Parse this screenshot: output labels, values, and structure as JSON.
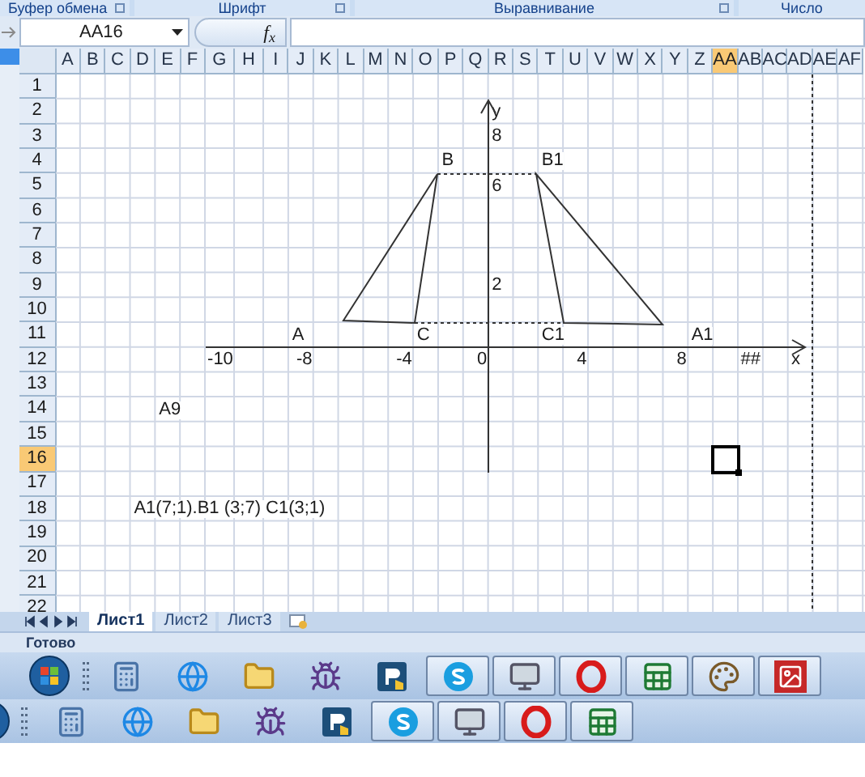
{
  "ribbon_groups": [
    {
      "label": "Буфер обмена"
    },
    {
      "label": "Шрифт"
    },
    {
      "label": "Выравнивание"
    },
    {
      "label": "Число"
    }
  ],
  "name_box": {
    "value": "AA16"
  },
  "formula_bar": {
    "function_label": "f$_{x}$"
  },
  "columns": [
    {
      "label": "A",
      "selected": false
    },
    {
      "label": "B",
      "selected": false
    },
    {
      "label": "C",
      "selected": false
    },
    {
      "label": "D",
      "selected": false
    },
    {
      "label": "E",
      "selected": false
    },
    {
      "label": "F",
      "selected": false
    },
    {
      "label": "G",
      "selected": false
    },
    {
      "label": "H",
      "selected": false
    },
    {
      "label": "I",
      "selected": false
    },
    {
      "label": "J",
      "selected": false
    },
    {
      "label": "K",
      "selected": false
    },
    {
      "label": "L",
      "selected": false
    },
    {
      "label": "M",
      "selected": false
    },
    {
      "label": "N",
      "selected": false
    },
    {
      "label": "O",
      "selected": false
    },
    {
      "label": "P",
      "selected": false
    },
    {
      "label": "Q",
      "selected": false
    },
    {
      "label": "R",
      "selected": false
    },
    {
      "label": "S",
      "selected": false
    },
    {
      "label": "T",
      "selected": false
    },
    {
      "label": "U",
      "selected": false
    },
    {
      "label": "V",
      "selected": false
    },
    {
      "label": "W",
      "selected": false
    },
    {
      "label": "X",
      "selected": false
    },
    {
      "label": "Y",
      "selected": false
    },
    {
      "label": "Z",
      "selected": false
    },
    {
      "label": "AA",
      "selected": true
    },
    {
      "label": "AB",
      "selected": false
    },
    {
      "label": "AC",
      "selected": false
    },
    {
      "label": "AD",
      "selected": false
    },
    {
      "label": "AE",
      "selected": false
    },
    {
      "label": "AF",
      "selected": false
    }
  ],
  "rows": [
    {
      "label": "1",
      "selected": false
    },
    {
      "label": "2",
      "selected": false
    },
    {
      "label": "3",
      "selected": false
    },
    {
      "label": "4",
      "selected": false
    },
    {
      "label": "5",
      "selected": false
    },
    {
      "label": "6",
      "selected": false
    },
    {
      "label": "7",
      "selected": false
    },
    {
      "label": "8",
      "selected": false
    },
    {
      "label": "9",
      "selected": false
    },
    {
      "label": "10",
      "selected": false
    },
    {
      "label": "11",
      "selected": false
    },
    {
      "label": "12",
      "selected": false
    },
    {
      "label": "13",
      "selected": false
    },
    {
      "label": "14",
      "selected": false
    },
    {
      "label": "15",
      "selected": false
    },
    {
      "label": "16",
      "selected": true
    },
    {
      "label": "17",
      "selected": false
    },
    {
      "label": "18",
      "selected": false
    },
    {
      "label": "19",
      "selected": false
    },
    {
      "label": "20",
      "selected": false
    },
    {
      "label": "21",
      "selected": false
    },
    {
      "label": "22",
      "selected": false
    }
  ],
  "cells": [
    {
      "text": "y"
    },
    {
      "text": "8"
    },
    {
      "text": "B"
    },
    {
      "text": "B1"
    },
    {
      "text": "6"
    },
    {
      "text": "2"
    },
    {
      "text": "A"
    },
    {
      "text": "C"
    },
    {
      "text": "C1"
    },
    {
      "text": "A1"
    },
    {
      "text": "-10"
    },
    {
      "text": "-8"
    },
    {
      "text": "-4"
    },
    {
      "text": "0"
    },
    {
      "text": "4"
    },
    {
      "text": "8"
    },
    {
      "text": "##"
    },
    {
      "text": "x"
    },
    {
      "text": "A9"
    },
    {
      "text": "A1(7;1).B1 (3;7)  C1(3;1)"
    }
  ],
  "sheet_tabs": [
    {
      "label": "Лист1",
      "selected": true
    },
    {
      "label": "Лист2",
      "selected": false
    },
    {
      "label": "Лист3",
      "selected": false
    }
  ],
  "status_bar": {
    "text": "Готово"
  },
  "taskbars": [
    {
      "items": [
        {
          "kind": "calculator",
          "running": false
        },
        {
          "kind": "browser",
          "running": false
        },
        {
          "kind": "folder",
          "running": false
        },
        {
          "kind": "spider",
          "running": false
        },
        {
          "kind": "remote",
          "running": false
        },
        {
          "kind": "skype",
          "running": true
        },
        {
          "kind": "monitor",
          "running": true
        },
        {
          "kind": "opera",
          "running": true
        },
        {
          "kind": "excel",
          "running": true
        },
        {
          "kind": "paint",
          "running": true
        },
        {
          "kind": "picture",
          "running": true
        }
      ]
    },
    {
      "items": [
        {
          "kind": "calculator",
          "running": false
        },
        {
          "kind": "browser",
          "running": false
        },
        {
          "kind": "folder",
          "running": false
        },
        {
          "kind": "spider",
          "running": false
        },
        {
          "kind": "remote",
          "running": false
        },
        {
          "kind": "skype",
          "running": true
        },
        {
          "kind": "monitor",
          "running": true
        },
        {
          "kind": "opera",
          "running": true
        },
        {
          "kind": "excel",
          "running": true
        }
      ]
    }
  ]
}
